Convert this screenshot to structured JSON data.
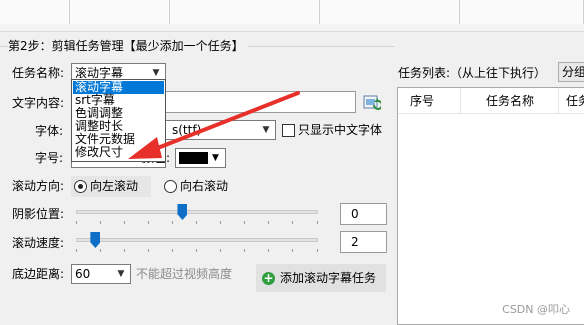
{
  "step": {
    "title": "第2步：剪辑任务管理【最少添加一个任务】"
  },
  "task_name": {
    "label": "任务名称:",
    "value": "滚动字幕",
    "options": [
      "滚动字幕",
      "srt字幕",
      "色调调整",
      "调整时长",
      "文件元数据",
      "修改尺寸"
    ]
  },
  "text_content": {
    "label": "文字内容:",
    "value": ""
  },
  "font": {
    "label": "字体:",
    "value": "s(ttf)",
    "only_chinese_label": "只显示中文字体",
    "only_chinese_checked": false
  },
  "font_size": {
    "label": "字号:",
    "value": "",
    "color_label": "颜色:",
    "color": "#000000"
  },
  "scroll_direction": {
    "label": "滚动方向:",
    "options": [
      {
        "label": "向左滚动",
        "selected": true
      },
      {
        "label": "向右滚动",
        "selected": false
      }
    ]
  },
  "shadow_position": {
    "label": "阴影位置:",
    "value": "0",
    "slider_fraction": 0.44
  },
  "scroll_speed": {
    "label": "滚动速度:",
    "value": "2",
    "slider_fraction": 0.08
  },
  "bottom_distance": {
    "label": "底边距离:",
    "value": "60",
    "hint": "不能超过视频高度"
  },
  "add_button": {
    "label": "添加滚动字幕任务"
  },
  "task_list": {
    "label": "任务列表:（从上往下执行）",
    "group_button": "分组",
    "columns": [
      "序号",
      "任务名称",
      "任务"
    ]
  },
  "watermark": "CSDN @叩心",
  "colors": {
    "selection": "#0078d7",
    "arrow": "#e8302a",
    "slider_thumb": "#0f6fc6",
    "add_icon": "#2f9e3f"
  }
}
